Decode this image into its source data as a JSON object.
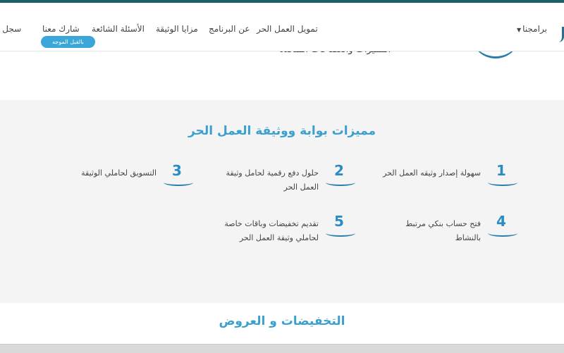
{
  "nav": {
    "programs": "برامجنا",
    "freelance_funding": "تمويل العمل الحر",
    "about_program": "عن البرنامج",
    "document_benefits": "مزايا الوثيقة",
    "faq": "الأسئلة الشائعة",
    "participate": "شارك معنا",
    "register_cut": "سجل معنا",
    "badge": "بالقبل الموجه"
  },
  "hero": {
    "cut_text": "المميزات والعضاعات المتحدة"
  },
  "features": {
    "title": "مميزات بوابة ووثيقة العمل الحر",
    "items": [
      {
        "number": "1",
        "text": "سهولة إصدار وثيقه العمل الحر"
      },
      {
        "number": "2",
        "line1": "حلول دفع رقمية لحامل وثيقة",
        "line2": "العمل الحر"
      },
      {
        "number": "3",
        "text": "التسويق لحاملي الوثيقة"
      },
      {
        "number": "4",
        "text": "فتح حساب بنكي مرتبط بالنشاط"
      },
      {
        "number": "5",
        "line1": "تقديم تخفيضات وباقات خاصة",
        "line2": "لحاملي وثيقة العمل الحر"
      }
    ]
  },
  "offers": {
    "title": "التخفيضات و العروض"
  },
  "colors": {
    "accent": "#3ba0cd",
    "number": "#2a8cc2",
    "topline": "#1f5f66",
    "section_bg": "#f4f4f4"
  }
}
